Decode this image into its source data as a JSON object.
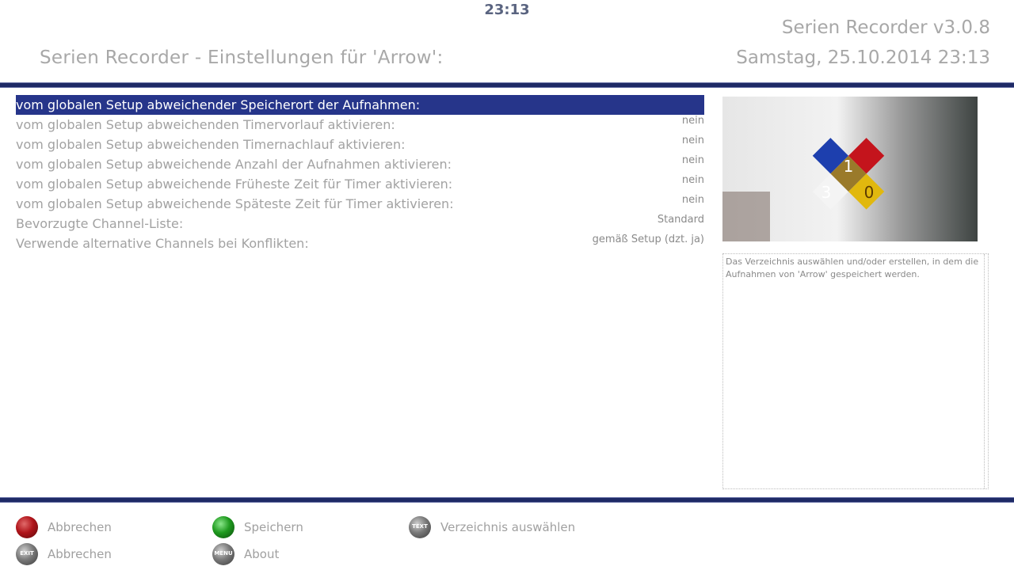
{
  "clock": "23:13",
  "header": {
    "title": "Serien Recorder - Einstellungen für 'Arrow':",
    "app_version": "Serien Recorder v3.0.8",
    "datetime": "Samstag, 25.10.2014  23:13"
  },
  "settings": [
    {
      "label": "vom globalen Setup abweichender Speicherort der Aufnahmen:",
      "value": "",
      "selected": true
    },
    {
      "label": "vom globalen Setup abweichenden Timervorlauf aktivieren:",
      "value": "nein",
      "selected": false
    },
    {
      "label": "vom globalen Setup abweichenden Timernachlauf aktivieren:",
      "value": "nein",
      "selected": false
    },
    {
      "label": "vom globalen Setup abweichende Anzahl der Aufnahmen aktivieren:",
      "value": "nein",
      "selected": false
    },
    {
      "label": "vom globalen Setup abweichende Früheste Zeit für Timer aktivieren:",
      "value": "nein",
      "selected": false
    },
    {
      "label": "vom globalen Setup abweichende Späteste Zeit für Timer aktivieren:",
      "value": "nein",
      "selected": false
    },
    {
      "label": "Bevorzugte Channel-Liste:",
      "value": "Standard",
      "selected": false
    },
    {
      "label": "Verwende alternative Channels bei Konflikten:",
      "value": "gemäß Setup (dzt. ja)",
      "selected": false
    }
  ],
  "preview": {
    "icon": "arrow-series-cover-image"
  },
  "description": "Das Verzeichnis auswählen und/oder erstellen, in dem die Aufnahmen von 'Arrow' gespeichert werden.",
  "keys": {
    "red_label": "Abbrechen",
    "green_label": "Speichern",
    "text_key_symbol": "TEXT",
    "text_key_label": "Verzeichnis auswählen",
    "exit_key_symbol": "EXIT",
    "exit_key_label": "Abbrechen",
    "menu_key_symbol": "MENU",
    "menu_key_label": "About"
  },
  "colors": {
    "accent": "#1e2a66",
    "selection": "#26358a",
    "red_key": "#b0141a",
    "green_key": "#1f9a1f"
  }
}
